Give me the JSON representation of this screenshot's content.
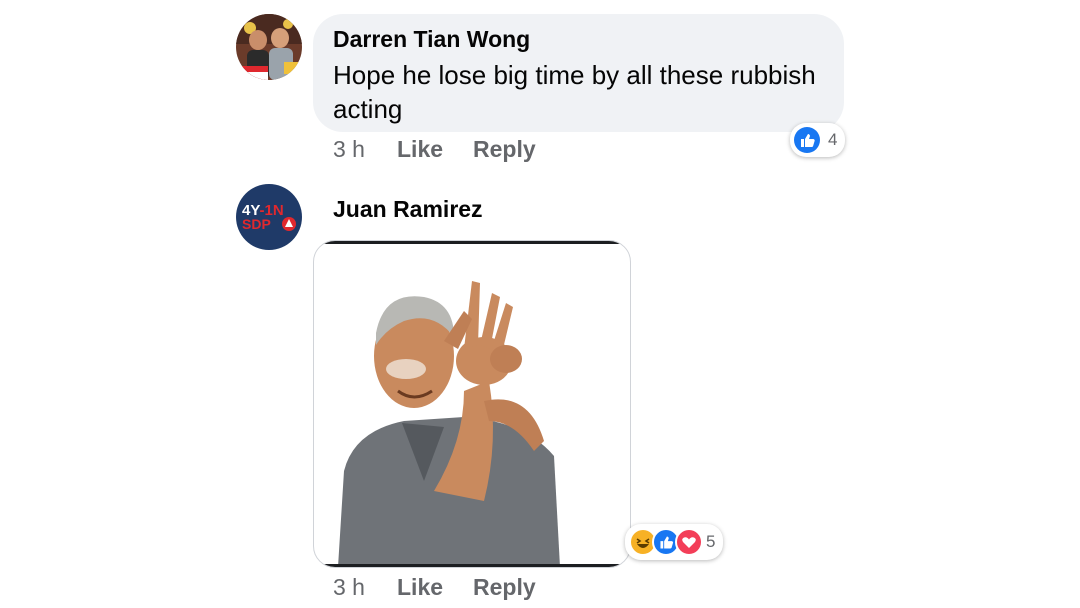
{
  "comments": [
    {
      "author": "Darren Tian Wong",
      "text": "Hope he lose big time by all these rubbish acting",
      "time": "3 h",
      "like_label": "Like",
      "reply_label": "Reply",
      "reaction_count": "4",
      "reaction_icons": [
        "like-icon"
      ]
    },
    {
      "author": "Juan Ramirez",
      "avatar_text": [
        "4Y-1N",
        "SDP"
      ],
      "image": "photo of smiling elderly man making a hand gesture on his forehead",
      "time": "3 h",
      "like_label": "Like",
      "reply_label": "Reply",
      "reaction_count": "5",
      "reaction_icons": [
        "haha-icon",
        "like-icon",
        "love-icon"
      ]
    }
  ],
  "colors": {
    "bubble": "#f0f2f5",
    "like_blue": "#1877f2",
    "love_red": "#f33e58",
    "haha_yellow": "#f7b125",
    "secondary_text": "#65676b",
    "sdp_navy": "#1f3a68",
    "sdp_red": "#e0282e"
  }
}
